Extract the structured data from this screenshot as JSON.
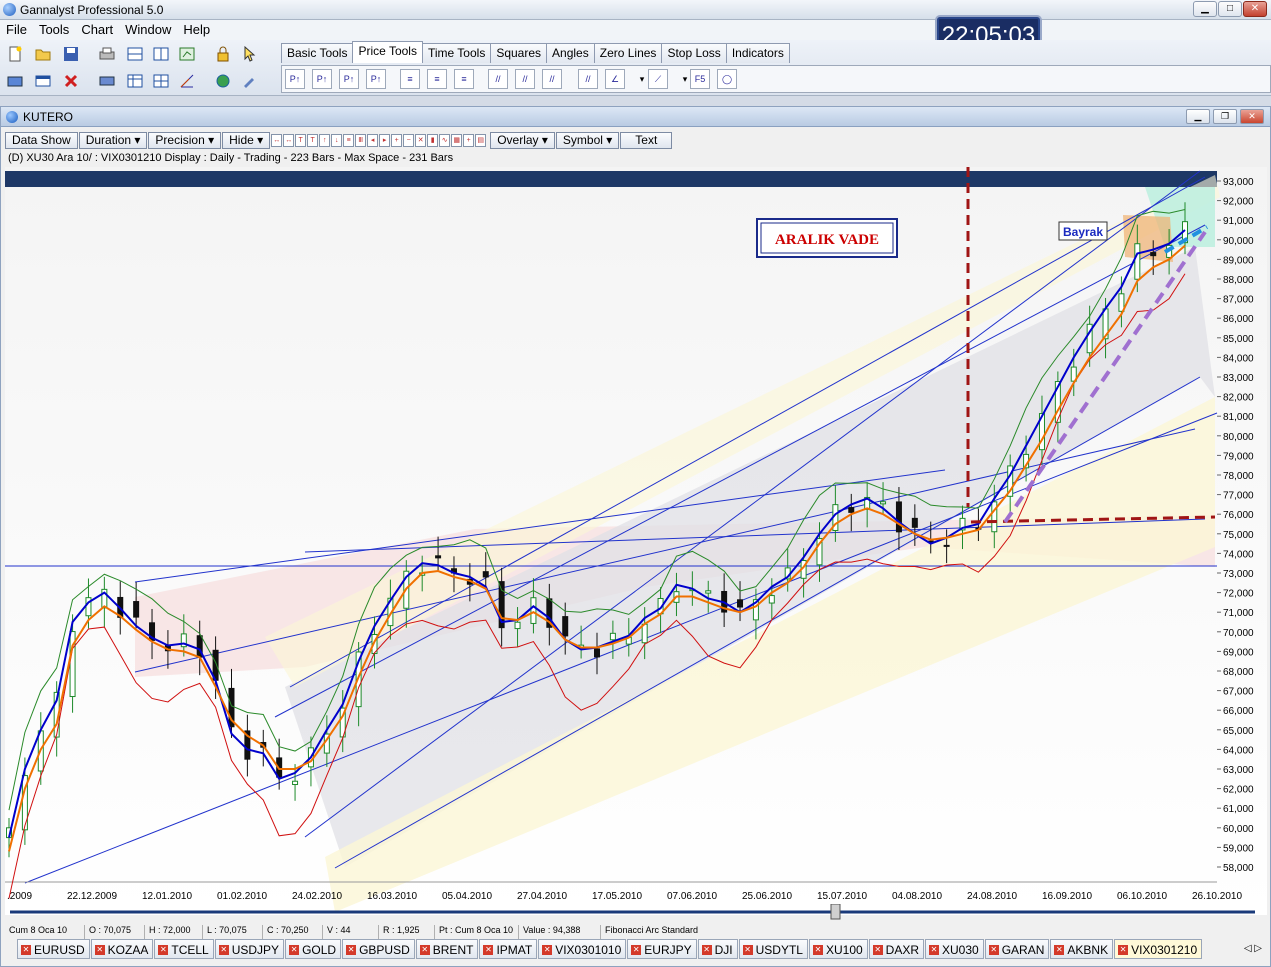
{
  "app": {
    "title": "Gannalyst Professional 5.0"
  },
  "menu": [
    "File",
    "Tools",
    "Chart",
    "Window",
    "Help"
  ],
  "clock": "22:05:03",
  "tabs": [
    "Basic Tools",
    "Price Tools",
    "Time Tools",
    "Squares",
    "Angles",
    "Zero Lines",
    "Stop Loss",
    "Indicators"
  ],
  "active_tab": "Price Tools",
  "window": {
    "title": "KUTERO"
  },
  "chart_toolbar": {
    "data_show": "Data Show",
    "duration": "Duration",
    "precision": "Precision",
    "hide": "Hide",
    "overlay": "Overlay",
    "symbol": "Symbol",
    "text": "Text"
  },
  "chart_info": "(D) XU30 Ara 10/ : VIX0301210 Display :  Daily  - Trading - 223 Bars -  Max Space - 231 Bars",
  "annotations": {
    "aralik": "ARALIK VADE",
    "bayrak": "Bayrak"
  },
  "status": {
    "date": "Cum 8 Oca 10",
    "open": "O : 70,075",
    "high": "H : 72,000",
    "low": "L : 70,075",
    "close": "C : 70,250",
    "volume": "V : 44",
    "range": "R : 1,925",
    "point": "Pt : Cum 8 Oca 10",
    "value": "Value : 94,388",
    "tool": "Fibonacci Arc Standard"
  },
  "symbols": [
    "EURUSD",
    "KOZAA",
    "TCELL",
    "USDJPY",
    "GOLD",
    "GBPUSD",
    "BRENT",
    "IPMAT",
    "VIX0301010",
    "EURJPY",
    "DJI",
    "USDYTL",
    "XU100",
    "DAXR",
    "XU030",
    "GARAN",
    "AKBNK",
    "VIX0301210"
  ],
  "active_symbol": "VIX0301210",
  "chart_data": {
    "type": "line",
    "x_labels": [
      ".2009",
      "22.12.2009",
      "12.01.2010",
      "01.02.2010",
      "24.02.2010",
      "16.03.2010",
      "05.04.2010",
      "27.04.2010",
      "17.05.2010",
      "07.06.2010",
      "25.06.2010",
      "15.07.2010",
      "04.08.2010",
      "24.08.2010",
      "16.09.2010",
      "06.10.2010",
      "26.10.2010"
    ],
    "y_labels": [
      "93,000",
      "92,000",
      "91,000",
      "90,000",
      "89,000",
      "88,000",
      "87,000",
      "86,000",
      "85,000",
      "84,000",
      "83,000",
      "82,000",
      "81,000",
      "80,000",
      "79,000",
      "78,000",
      "77,000",
      "76,000",
      "75,000",
      "74,000",
      "73,000",
      "72,000",
      "71,000",
      "70,000",
      "69,000",
      "68,000",
      "67,000",
      "66,000",
      "65,000",
      "64,000",
      "63,000",
      "62,000",
      "61,000",
      "60,000",
      "59,000",
      "58,000"
    ],
    "ylim": [
      58000,
      93000
    ],
    "series": [
      {
        "color": "#0000cc",
        "values": [
          59.5,
          63,
          65,
          66.5,
          70.5,
          71.5,
          72,
          71.2,
          70.3,
          69.7,
          69.3,
          69.4,
          69.1,
          67.5,
          64.8,
          64,
          63.8,
          62.5,
          62.8,
          63.6,
          65,
          66.3,
          68.5,
          70.3,
          71.6,
          72.8,
          73.5,
          73.4,
          73,
          72.8,
          72.3,
          70.5,
          70.6,
          71.3,
          70.7,
          69.6,
          69.1,
          69.2,
          69.5,
          69.8,
          70.7,
          71.2,
          72.4,
          72.2,
          71.7,
          71.5,
          71,
          71.5,
          72.3,
          72.8,
          73.8,
          75,
          76,
          76.5,
          76.8,
          76.3,
          75.6,
          75,
          74.5,
          74.8,
          75.3,
          75.5,
          76.8,
          78,
          79.5,
          81,
          82.5,
          84,
          85.3,
          86.5,
          87.6,
          89.3,
          89.5,
          89.8,
          90.5
        ]
      },
      {
        "color": "#f07000",
        "values": [
          58.8,
          62,
          64,
          65.3,
          69.3,
          70.6,
          71.3,
          70.8,
          70.1,
          69.5,
          69.1,
          69,
          68.7,
          67.2,
          65.5,
          64.7,
          64.2,
          63,
          63,
          63.4,
          64.5,
          65.7,
          67.7,
          69.5,
          70.9,
          72.2,
          73,
          73.1,
          72.8,
          72.6,
          72.2,
          70.7,
          70.6,
          71,
          70.5,
          69.6,
          69.2,
          69.2,
          69.4,
          69.7,
          70.4,
          70.9,
          71.8,
          71.8,
          71.5,
          71.2,
          71,
          71.3,
          72,
          72.5,
          73.3,
          74.5,
          75.5,
          76,
          76.3,
          76,
          75.5,
          75,
          74.7,
          74.8,
          75,
          75.2,
          76.2,
          77.2,
          78.5,
          79.8,
          81.3,
          82.7,
          84,
          85.1,
          86.2,
          87.9,
          88.6,
          89,
          89.7
        ]
      }
    ]
  }
}
